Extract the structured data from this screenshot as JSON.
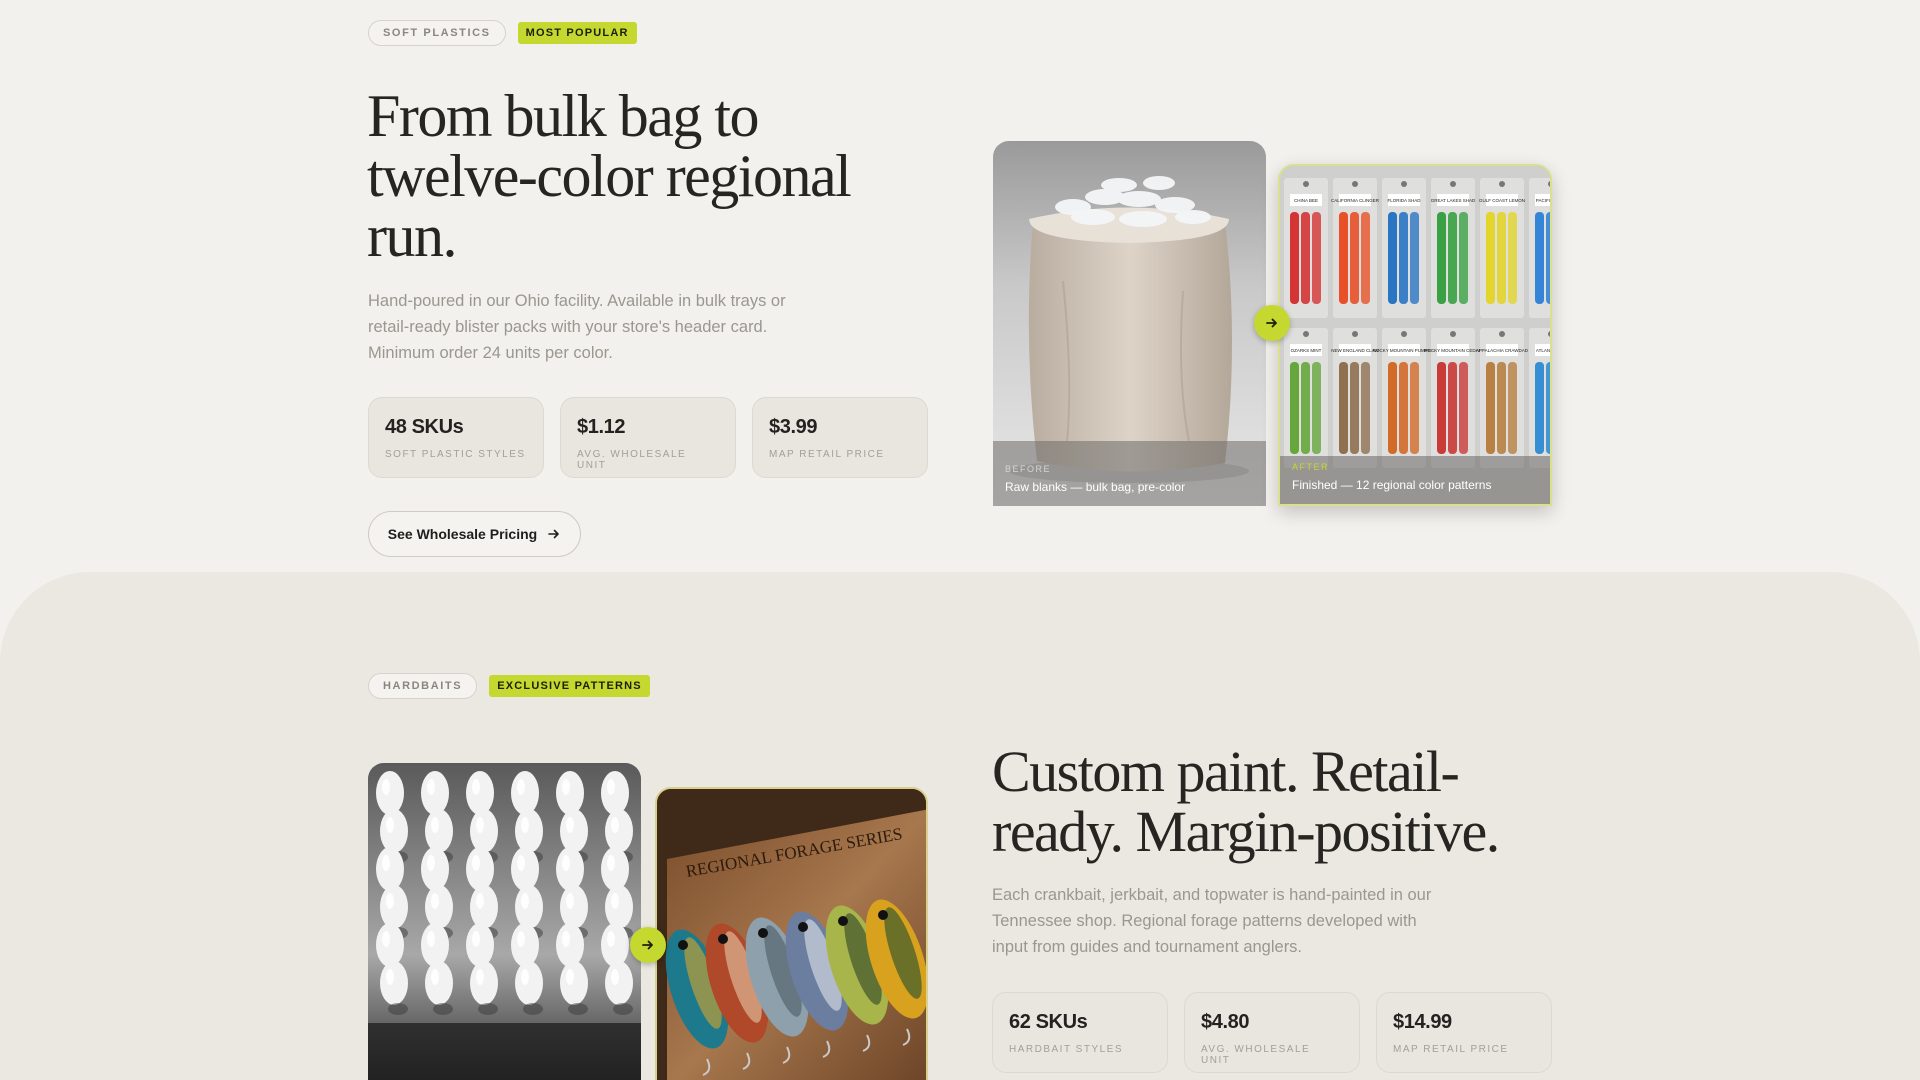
{
  "colors": {
    "accent": "#c5d82f",
    "background": "#f3f1ed",
    "section_alt": "#ebe8e2"
  },
  "soft_plastics": {
    "tag": "SOFT PLASTICS",
    "badge": "MOST POPULAR",
    "headline_lines": [
      "From bulk bag to",
      "twelve-color regional",
      "run."
    ],
    "body_lines": [
      "Hand-poured in our Ohio facility. Available in bulk trays or",
      "retail-ready blister packs with your store's header card.",
      "Minimum order 24 units per color."
    ],
    "stats": [
      {
        "value": "48 SKUs",
        "label": "SOFT PLASTIC STYLES"
      },
      {
        "value": "$1.12",
        "label": "AVG. WHOLESALE UNIT"
      },
      {
        "value": "$3.99",
        "label": "MAP RETAIL PRICE"
      }
    ],
    "cta_label": "See Wholesale Pricing",
    "before_kicker": "BEFORE",
    "before_caption": "Raw blanks — bulk bag, pre-color",
    "after_kicker": "AFTER",
    "after_caption": "Finished — 12 regional color patterns",
    "pack_labels": [
      "CHINA BEE",
      "CALIFORNIA CLINGER",
      "FLORIDA SHAD",
      "GREAT LAKES SHAD",
      "GULF COAST LEMON",
      "PACIFIC BLUE",
      "OZARKS MINT",
      "NEW ENGLAND CLAW",
      "ROCKY MOUNTAIN PUMPKIN",
      "ROCKY MOUNTAIN CEDAR",
      "APPALACHIA CRAWDAD",
      "ATLANTIC ICE"
    ],
    "arrow_icon": "arrow-right-icon"
  },
  "hardbaits": {
    "tag": "HARDBAITS",
    "badge": "EXCLUSIVE PATTERNS",
    "headline_lines": [
      "Custom paint. Retail-",
      "ready. Margin-positive."
    ],
    "body_lines": [
      "Each crankbait, jerkbait, and topwater is hand-painted in our",
      "Tennessee shop. Regional forage patterns developed with",
      "input from guides and tournament anglers."
    ],
    "stats": [
      {
        "value": "62 SKUs",
        "label": "HARDBAIT STYLES"
      },
      {
        "value": "$4.80",
        "label": "AVG. WHOLESALE UNIT"
      },
      {
        "value": "$14.99",
        "label": "MAP RETAIL PRICE"
      }
    ],
    "sign_text": "REGIONAL FORAGE SERIES",
    "arrow_icon": "arrow-right-icon"
  }
}
